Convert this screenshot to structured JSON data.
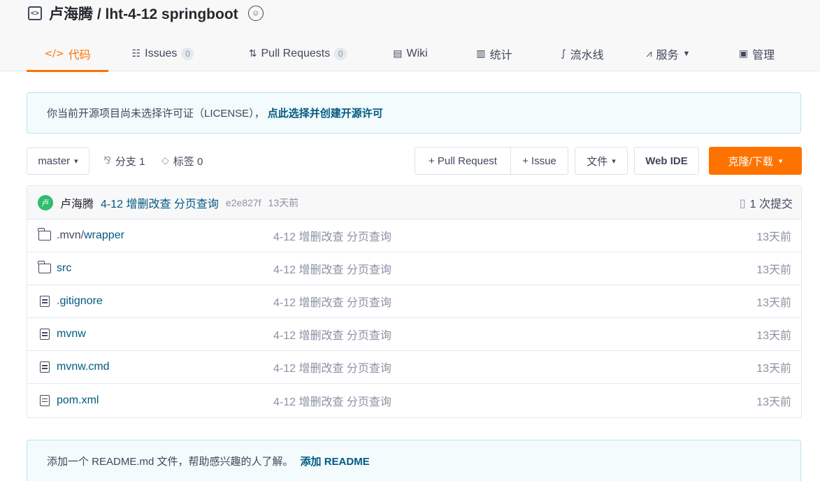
{
  "repo": {
    "title": "卢海腾 / lht-4-12 springboot",
    "icon": "code-square-icon",
    "badge_icon": "recommend-badge-icon"
  },
  "tabs": [
    {
      "label": "代码",
      "icon": "code-icon",
      "active": true
    },
    {
      "label": "Issues",
      "icon": "issues-icon",
      "count": "0"
    },
    {
      "label": "Pull Requests",
      "icon": "pull-request-icon",
      "count": "0"
    },
    {
      "label": "Wiki",
      "icon": "wiki-icon"
    },
    {
      "label": "统计",
      "icon": "stats-icon"
    },
    {
      "label": "流水线",
      "icon": "pipeline-icon"
    },
    {
      "label": "服务",
      "icon": "service-icon",
      "dropdown": true
    },
    {
      "label": "管理",
      "icon": "manage-icon"
    }
  ],
  "license_notice": {
    "text": "你当前开源项目尚未选择许可证（LICENSE），",
    "link": "点此选择并创建开源许可"
  },
  "toolbar": {
    "branch": "master",
    "branches_label": "分支 1",
    "tags_label": "标签 0",
    "pull_request": "+ Pull Request",
    "issue": "+ Issue",
    "files": "文件",
    "web_ide": "Web IDE",
    "clone": "克隆/下载"
  },
  "last_commit": {
    "avatar_letter": "卢",
    "author": "卢海腾",
    "message": "4-12 增删改查 分页查询",
    "sha": "e2e827f",
    "time": "13天前",
    "commit_count": "1 次提交"
  },
  "files": [
    {
      "type": "folder",
      "name_muted": ".mvn/",
      "name": "wrapper",
      "message": "4-12 增删改查 分页查询",
      "time": "13天前"
    },
    {
      "type": "folder",
      "name_muted": "",
      "name": "src",
      "message": "4-12 增删改查 分页查询",
      "time": "13天前"
    },
    {
      "type": "file",
      "name_muted": "",
      "name": ".gitignore",
      "message": "4-12 增删改查 分页查询",
      "time": "13天前"
    },
    {
      "type": "file",
      "name_muted": "",
      "name": "mvnw",
      "message": "4-12 增删改查 分页查询",
      "time": "13天前"
    },
    {
      "type": "file",
      "name_muted": "",
      "name": "mvnw.cmd",
      "message": "4-12 增删改查 分页查询",
      "time": "13天前"
    },
    {
      "type": "file",
      "name_muted": "",
      "name": "pom.xml",
      "message": "4-12 增删改查 分页查询",
      "time": "13天前"
    }
  ],
  "readme_notice": {
    "text": "添加一个 README.md 文件，帮助感兴趣的人了解。",
    "link": "添加 README"
  },
  "colors": {
    "accent": "#fe7300",
    "link": "#005980",
    "notice_bg": "#f3fbfd",
    "avatar": "#2fbd6e"
  }
}
